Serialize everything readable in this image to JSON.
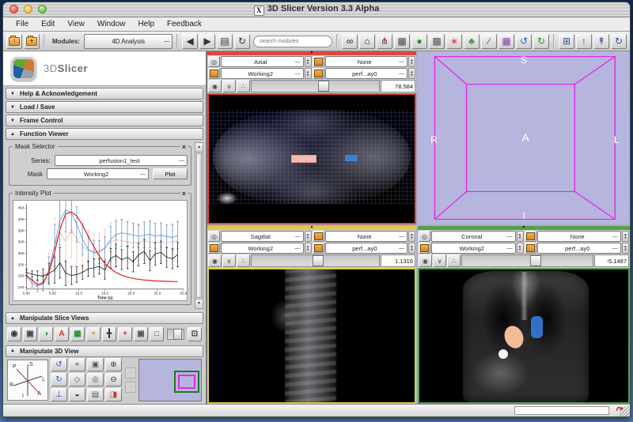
{
  "window": {
    "title": "3D Slicer Version 3.3 Alpha",
    "app_icon": "X"
  },
  "menu": {
    "items": [
      "File",
      "Edit",
      "View",
      "Window",
      "Help",
      "Feedback"
    ]
  },
  "ui": {
    "collapse_tri": "▲",
    "combo_dash": "—",
    "spinner_up": "▲",
    "spinner_down": "▼",
    "slice_menu_glyph": "◎",
    "visibility_glyph": "◉",
    "expand_glyph": "∨",
    "lightbox_glyph": "∴",
    "close_x": "×",
    "scroll_up": "▲",
    "scroll_down": "▼"
  },
  "toolbar": {
    "modules_label": "Modules:",
    "modules_value": "4D Analysis",
    "search_placeholder": "search modules",
    "file_buttons": [
      {
        "name": "load-scene-button",
        "glyph": "↑",
        "color": "#8a2a1a",
        "cls": "folder"
      },
      {
        "name": "save-scene-button",
        "glyph": "+",
        "color": "#1a5a1a",
        "cls": "folder"
      }
    ],
    "nav_buttons": [
      {
        "name": "module-back-button",
        "glyph": "◀",
        "color": "#333333"
      },
      {
        "name": "module-forward-button",
        "glyph": "▶",
        "color": "#333333"
      },
      {
        "name": "module-history-button",
        "glyph": "▤",
        "color": "#333333"
      },
      {
        "name": "module-refresh-button",
        "glyph": "↻",
        "color": "#333333"
      }
    ],
    "module_buttons": [
      {
        "name": "search-modules-icon",
        "glyph": "∞",
        "color": "#222222"
      },
      {
        "name": "home-module-icon",
        "glyph": "⌂",
        "color": "#333333"
      },
      {
        "name": "modules-graph-icon",
        "glyph": "⋔",
        "color": "#7a2020"
      },
      {
        "name": "volumes-module-icon",
        "glyph": "▦",
        "color": "#444444"
      },
      {
        "name": "models-module-icon",
        "glyph": "●",
        "color": "#2d8f2d"
      },
      {
        "name": "transforms-module-icon",
        "glyph": "▩",
        "color": "#555555"
      },
      {
        "name": "fiducials-module-icon",
        "glyph": "∗",
        "color": "#cc4444"
      },
      {
        "name": "editor-module-icon",
        "glyph": "♣",
        "color": "#3d9a3d"
      },
      {
        "name": "measurements-module-icon",
        "glyph": "∕",
        "color": "#b03030"
      },
      {
        "name": "colors-module-icon",
        "glyph": "▦",
        "color": "#7a3fa0"
      },
      {
        "name": "undo-button",
        "glyph": "↺",
        "color": "#2255cc"
      },
      {
        "name": "redo-button",
        "glyph": "↻",
        "color": "#2d8f2d"
      }
    ],
    "view_buttons": [
      {
        "name": "layout-button",
        "glyph": "⊞",
        "color": "#2a4faa"
      },
      {
        "name": "fiducial-add-button",
        "glyph": "↑",
        "color": "#2a4faa"
      },
      {
        "name": "fiducial-select-button",
        "glyph": "↟",
        "color": "#2a4faa"
      },
      {
        "name": "screen-capture-button",
        "glyph": "↻",
        "color": "#2a4faa"
      }
    ]
  },
  "left_panel": {
    "logo_3d": "3D",
    "logo_slicer": "Slicer",
    "sections": [
      {
        "label": "Help & Acknowledgement",
        "arrow": "▼"
      },
      {
        "label": "Load / Save",
        "arrow": "▼"
      },
      {
        "label": "Frame Control",
        "arrow": "▼"
      },
      {
        "label": "Function Viewer",
        "arrow": "▲"
      }
    ],
    "mask_selector": {
      "title": "Mask Selector",
      "series_label": "Series:",
      "series_value": "perfusion1_test",
      "mask_label": "Mask",
      "mask_value": "Working2",
      "plot_button": "Plot"
    },
    "intensity_plot": {
      "title": "Intensity Plot"
    },
    "slice_views": {
      "label": "Manipulate Slice Views",
      "icons": [
        {
          "name": "slice-visibility-icon",
          "glyph": "◉",
          "color": "#333333"
        },
        {
          "name": "label-opacity-icon",
          "glyph": "▣",
          "color": "#444444"
        },
        {
          "name": "lightbox-icon",
          "glyph": "◑",
          "color": "#2d8f2d"
        },
        {
          "name": "annotation-icon",
          "glyph": "A",
          "color": "#cc3333"
        },
        {
          "name": "compositing-icon",
          "glyph": "▦",
          "color": "#2d8f2d"
        },
        {
          "name": "crosshair-icon",
          "glyph": "+",
          "color": "#c8a800"
        },
        {
          "name": "spatial-grid-icon",
          "glyph": "╋",
          "color": "#333333"
        },
        {
          "name": "navigation-crosshair-icon",
          "glyph": "+",
          "color": "#cc3333"
        },
        {
          "name": "fit-to-window-icon",
          "glyph": "▣",
          "color": "#555555"
        },
        {
          "name": "single-slice-icon",
          "glyph": "□",
          "color": "#555555"
        }
      ],
      "fov_button": [
        {
          "name": "field-of-view-button",
          "glyph": "⊡",
          "color": "#333333"
        }
      ]
    },
    "view3d": {
      "label": "Manipulate 3D View",
      "axis_letters": [
        "P",
        "S",
        "L",
        "R",
        "A",
        "I"
      ],
      "icons": [
        {
          "name": "rotate-view-icon",
          "glyph": "↺",
          "color": "#2255cc"
        },
        {
          "name": "center-view-icon",
          "glyph": "⌖",
          "color": "#555555"
        },
        {
          "name": "stereo-icon",
          "glyph": "▣",
          "color": "#555555"
        },
        {
          "name": "zoom-in-icon",
          "glyph": "⊕",
          "color": "#333333"
        },
        {
          "name": "spin-view-icon",
          "glyph": "↻",
          "color": "#2255cc"
        },
        {
          "name": "orthographic-icon",
          "glyph": "◇",
          "color": "#555555"
        },
        {
          "name": "look-from-icon",
          "glyph": "◎",
          "color": "#555555"
        },
        {
          "name": "zoom-out-icon",
          "glyph": "⊖",
          "color": "#333333"
        },
        {
          "name": "pitch-view-icon",
          "glyph": "⊥",
          "color": "#2255cc"
        },
        {
          "name": "visibility-3d-icon",
          "glyph": "◒",
          "color": "#333333"
        },
        {
          "name": "screen-grab-icon",
          "glyph": "▤",
          "color": "#555555"
        },
        {
          "name": "stereo-redblue-icon",
          "glyph": "◨",
          "color": "#cc3333"
        }
      ],
      "mini_icons": [
        {
          "name": "ruler-toggle-icon",
          "glyph": "▫",
          "color": "#777777"
        },
        {
          "name": "look-at-toggle-icon",
          "glyph": "▫",
          "color": "#777777"
        }
      ]
    }
  },
  "viewports": {
    "axial": {
      "orientation": "Axial",
      "fg": "None",
      "label_map": "Working2",
      "bg": "perf...ay0",
      "slice_value": "78.584",
      "accent": "#e0463a"
    },
    "sagittal": {
      "orientation": "Sagittal",
      "fg": "None",
      "label_map": "Working2",
      "bg": "perf...ay0",
      "slice_value": "1.1316",
      "accent": "#ddc94f"
    },
    "coronal": {
      "orientation": "Coronal",
      "fg": "None",
      "label_map": "Working2",
      "bg": "perf...ay0",
      "slice_value": "-5.1487",
      "accent": "#54a04c"
    },
    "view3d": {
      "background": "#b5b5de",
      "wire_color": "#e820e8",
      "labels": {
        "top": "S",
        "bottom": "I",
        "left": "R",
        "right": "L",
        "center": "A"
      }
    }
  },
  "chart_data": {
    "type": "line",
    "title": "Intensity Plot",
    "xlabel": "Time (s)",
    "ylabel": "",
    "xlim": [
      0,
      30
    ],
    "ylim": [
      100,
      450
    ],
    "ylim_draw": [
      92,
      468
    ],
    "grid": false,
    "legend": "none",
    "xticks": [
      {
        "v": 0,
        "l": "0.00"
      },
      {
        "v": 5,
        "l": "5.00"
      },
      {
        "v": 10,
        "l": "10.0"
      },
      {
        "v": 15,
        "l": "15.0"
      },
      {
        "v": 20,
        "l": "20.0"
      },
      {
        "v": 25,
        "l": "25.0"
      },
      {
        "v": 30,
        "l": "30.0"
      }
    ],
    "yticks": [
      {
        "v": 450,
        "l": "450"
      },
      {
        "v": 400,
        "l": "400"
      },
      {
        "v": 350,
        "l": "350"
      },
      {
        "v": 300,
        "l": "300"
      },
      {
        "v": 250,
        "l": "250"
      },
      {
        "v": 200,
        "l": "200"
      },
      {
        "v": 150,
        "l": "150"
      },
      {
        "v": 100,
        "l": "100"
      }
    ],
    "x": [
      0,
      1.1,
      2.1,
      3.2,
      4.3,
      5.4,
      6.4,
      7.5,
      8.6,
      9.6,
      10.7,
      11.8,
      12.9,
      13.9,
      15,
      16.1,
      17.1,
      18.2,
      19.3,
      20.4,
      21.4,
      22.5,
      23.6,
      24.6,
      25.7,
      26.8,
      27.9,
      28.9
    ],
    "series": [
      {
        "name": "region2-mean-sd",
        "color": "#f4b8a8",
        "errorbars": true,
        "values": [
          158,
          128,
          112,
          122,
          182,
          288,
          342,
          302,
          358,
          312,
          282,
          262,
          256,
          262,
          276,
          300,
          310,
          306,
          300,
          296,
          300,
          306,
          300,
          296,
          300,
          296,
          300,
          306
        ],
        "errors": [
          12,
          16,
          22,
          34,
          72,
          118,
          148,
          138,
          128,
          118,
          98,
          88,
          80,
          80,
          80,
          86,
          90,
          90,
          86,
          84,
          80,
          86,
          90,
          86,
          84,
          80,
          86,
          90
        ]
      },
      {
        "name": "region1-mean-sd",
        "color": "#5b8fd4",
        "errorbars": true,
        "values": [
          152,
          118,
          104,
          116,
          172,
          285,
          395,
          442,
          428,
          378,
          312,
          268,
          252,
          256,
          272,
          312,
          332,
          340,
          336,
          330,
          326,
          330,
          334,
          326,
          330,
          324,
          320,
          330
        ],
        "errors": [
          14,
          18,
          24,
          32,
          62,
          92,
          108,
          98,
          88,
          78,
          68,
          58,
          54,
          50,
          50,
          56,
          60,
          60,
          56,
          54,
          50,
          56,
          60,
          56,
          54,
          50,
          56,
          60
        ]
      },
      {
        "name": "region3-mean-sd",
        "color": "#1a1a1a",
        "errorbars": true,
        "values": [
          165,
          158,
          152,
          150,
          162,
          176,
          208,
          162,
          152,
          156,
          166,
          182,
          186,
          192,
          176,
          228,
          240,
          222,
          232,
          212,
          244,
          258,
          218,
          248,
          254,
          232,
          226,
          244
        ],
        "errors": [
          14,
          14,
          20,
          30,
          44,
          58,
          68,
          54,
          40,
          34,
          30,
          34,
          40,
          34,
          40,
          44,
          50,
          44,
          50,
          44,
          50,
          54,
          44,
          50,
          50,
          44,
          44,
          54
        ]
      },
      {
        "name": "gamma-fit-curve",
        "color": "#e02020",
        "errorbars": false,
        "values": [
          150,
          132,
          112,
          118,
          165,
          255,
          355,
          425,
          432,
          415,
          375,
          325,
          278,
          238,
          205,
          182,
          165,
          153,
          145,
          139,
          135,
          132,
          130,
          128,
          127,
          126,
          125,
          125
        ]
      }
    ]
  },
  "status_bar": {
    "swoosh": "↷"
  }
}
